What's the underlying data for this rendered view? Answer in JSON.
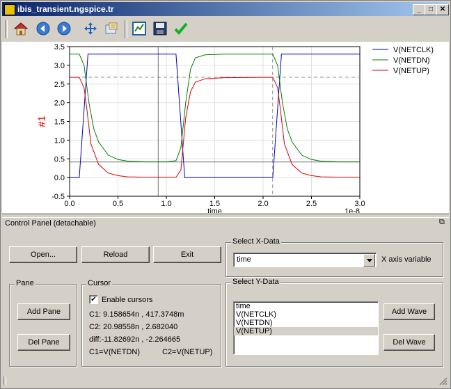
{
  "window": {
    "title": "ibis_transient.ngspice.tr"
  },
  "toolbar": {
    "icons": [
      "home-icon",
      "back-icon",
      "forward-icon",
      "pan-icon",
      "zoom-icon",
      "configure-subplots-icon",
      "save-icon",
      "check-icon"
    ]
  },
  "chart_data": {
    "type": "line",
    "ylabel": "#1",
    "xlabel": "time",
    "x_offset_label": "1e-8",
    "xlim": [
      0.0,
      3.0
    ],
    "ylim": [
      -0.5,
      3.5
    ],
    "xticks": [
      "0.0",
      "0.5",
      "1.0",
      "1.5",
      "2.0",
      "2.5",
      "3.0"
    ],
    "yticks": [
      "-0.5",
      "0.0",
      "0.5",
      "1.0",
      "1.5",
      "2.0",
      "2.5",
      "3.0",
      "3.5"
    ],
    "grid": true,
    "legend": "top-right outside",
    "cursor1": {
      "x": 0.9158654,
      "y": 0.4173748
    },
    "cursor2": {
      "x": 2.098558,
      "y": 2.68204
    },
    "series": [
      {
        "name": "V(NETCLK)",
        "color": "#0000cc",
        "x": [
          0.0,
          0.1,
          0.19,
          0.2,
          1.1,
          1.19,
          1.2,
          2.1,
          2.19,
          2.2,
          3.0
        ],
        "y": [
          0.0,
          0.0,
          3.3,
          3.3,
          3.3,
          0.0,
          0.0,
          0.0,
          3.3,
          3.3,
          3.3
        ]
      },
      {
        "name": "V(NETDN)",
        "color": "#008000",
        "x": [
          0.0,
          0.1,
          0.15,
          0.2,
          0.25,
          0.3,
          0.4,
          0.5,
          0.6,
          0.8,
          1.0,
          1.1,
          1.15,
          1.2,
          1.25,
          1.3,
          1.4,
          1.6,
          2.0,
          2.1,
          2.15,
          2.2,
          2.25,
          2.3,
          2.4,
          2.5,
          2.6,
          2.8,
          3.0
        ],
        "y": [
          3.3,
          3.3,
          3.0,
          2.0,
          1.3,
          0.95,
          0.6,
          0.48,
          0.44,
          0.42,
          0.42,
          0.45,
          0.8,
          2.0,
          2.9,
          3.2,
          3.28,
          3.3,
          3.3,
          3.3,
          3.0,
          2.0,
          1.3,
          0.95,
          0.6,
          0.48,
          0.44,
          0.42,
          0.42
        ]
      },
      {
        "name": "V(NETUP)",
        "color": "#dd0000",
        "x": [
          0.0,
          0.1,
          0.15,
          0.18,
          0.22,
          0.3,
          0.4,
          0.5,
          0.6,
          0.8,
          1.0,
          1.1,
          1.15,
          1.2,
          1.25,
          1.3,
          1.4,
          1.6,
          2.0,
          2.1,
          2.15,
          2.18,
          2.22,
          2.3,
          2.4,
          2.5,
          2.6,
          2.8,
          3.0
        ],
        "y": [
          2.68,
          2.68,
          2.4,
          1.8,
          0.9,
          0.35,
          0.12,
          0.05,
          0.02,
          0.01,
          0.01,
          0.01,
          0.2,
          1.6,
          2.3,
          2.55,
          2.64,
          2.67,
          2.68,
          2.68,
          2.4,
          1.8,
          0.9,
          0.35,
          0.12,
          0.05,
          0.02,
          0.01,
          0.01
        ]
      }
    ]
  },
  "control_panel": {
    "title": "Control Panel (detachable)",
    "buttons": {
      "open": "Open...",
      "reload": "Reload",
      "exit": "Exit"
    },
    "pane": {
      "label": "Pane",
      "add": "Add Pane",
      "del": "Del Pane"
    },
    "cursor": {
      "label": "Cursor",
      "enable_label": "Enable cursors",
      "enabled": true,
      "c1": "C1:  9.158654n   ,  417.3748m",
      "c2": "C2:  20.98558n   ,  2.682040",
      "diff": "diff:-11.82692n  ,  -2.264665",
      "c1_trace": "C1=V(NETDN)",
      "c2_trace": "C2=V(NETUP)"
    },
    "xdata": {
      "label": "Select X-Data",
      "selected": "time",
      "axis_label": "X axis variable"
    },
    "ydata": {
      "label": "Select Y-Data",
      "items": [
        "time",
        "V(NETCLK)",
        "V(NETDN)",
        "V(NETUP)"
      ],
      "selected_index": 3,
      "add": "Add Wave",
      "del": "Del Wave"
    }
  }
}
